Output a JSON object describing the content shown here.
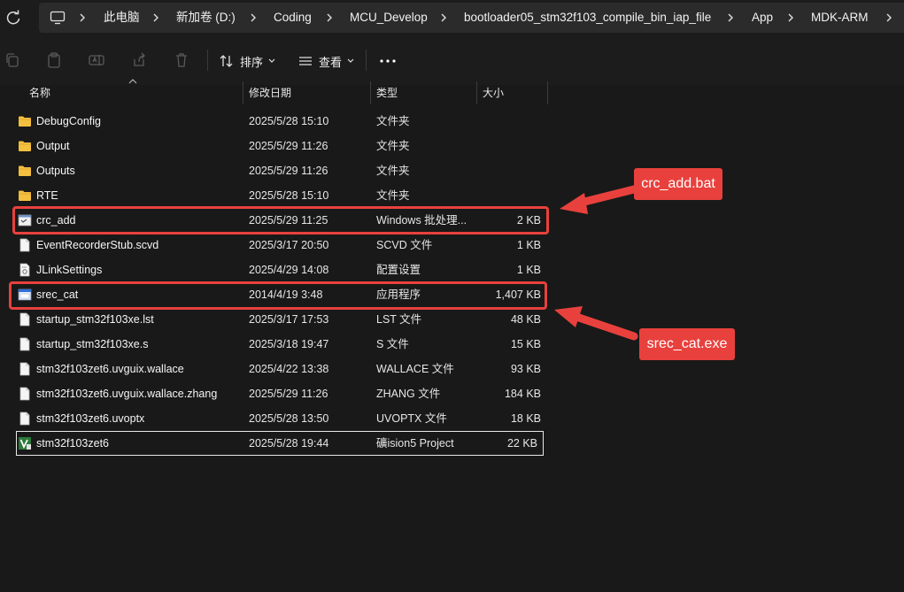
{
  "breadcrumb": {
    "items": [
      "此电脑",
      "新加卷 (D:)",
      "Coding",
      "MCU_Develop",
      "bootloader05_stm32f103_compile_bin_iap_file",
      "App",
      "MDK-ARM"
    ]
  },
  "toolbar": {
    "sort_label": "排序",
    "view_label": "查看"
  },
  "columns": {
    "name": "名称",
    "modified": "修改日期",
    "type": "类型",
    "size": "大小"
  },
  "files": [
    {
      "name": "DebugConfig",
      "modified": "2025/5/28 15:10",
      "type": "文件夹",
      "size": "",
      "icon": "folder-icon"
    },
    {
      "name": "Output",
      "modified": "2025/5/29 11:26",
      "type": "文件夹",
      "size": "",
      "icon": "folder-icon"
    },
    {
      "name": "Outputs",
      "modified": "2025/5/29 11:26",
      "type": "文件夹",
      "size": "",
      "icon": "folder-icon"
    },
    {
      "name": "RTE",
      "modified": "2025/5/28 15:10",
      "type": "文件夹",
      "size": "",
      "icon": "folder-icon"
    },
    {
      "name": "crc_add",
      "modified": "2025/5/29 11:25",
      "type": "Windows 批处理...",
      "size": "2 KB",
      "icon": "batch-file-icon"
    },
    {
      "name": "EventRecorderStub.scvd",
      "modified": "2025/3/17 20:50",
      "type": "SCVD 文件",
      "size": "1 KB",
      "icon": "file-icon"
    },
    {
      "name": "JLinkSettings",
      "modified": "2025/4/29 14:08",
      "type": "配置设置",
      "size": "1 KB",
      "icon": "settings-file-icon"
    },
    {
      "name": "srec_cat",
      "modified": "2014/4/19 3:48",
      "type": "应用程序",
      "size": "1,407 KB",
      "icon": "application-icon"
    },
    {
      "name": "startup_stm32f103xe.lst",
      "modified": "2025/3/17 17:53",
      "type": "LST 文件",
      "size": "48 KB",
      "icon": "file-icon"
    },
    {
      "name": "startup_stm32f103xe.s",
      "modified": "2025/3/18 19:47",
      "type": "S 文件",
      "size": "15 KB",
      "icon": "file-icon"
    },
    {
      "name": "stm32f103zet6.uvguix.wallace",
      "modified": "2025/4/22 13:38",
      "type": "WALLACE 文件",
      "size": "93 KB",
      "icon": "file-icon"
    },
    {
      "name": "stm32f103zet6.uvguix.wallace.zhang",
      "modified": "2025/5/29 11:26",
      "type": "ZHANG 文件",
      "size": "184 KB",
      "icon": "file-icon"
    },
    {
      "name": "stm32f103zet6.uvoptx",
      "modified": "2025/5/28 13:50",
      "type": "UVOPTX 文件",
      "size": "18 KB",
      "icon": "file-icon"
    },
    {
      "name": "stm32f103zet6",
      "modified": "2025/5/28 19:44",
      "type": "礦ision5 Project",
      "size": "22 KB",
      "icon": "keil-project-icon"
    }
  ],
  "annotations": {
    "crc_label": "crc_add.bat",
    "srec_label": "srec_cat.exe",
    "color": "#e8413d"
  },
  "colors": {
    "background": "#191919",
    "folder": "#f4c03f",
    "accent_red": "#e8413d"
  }
}
